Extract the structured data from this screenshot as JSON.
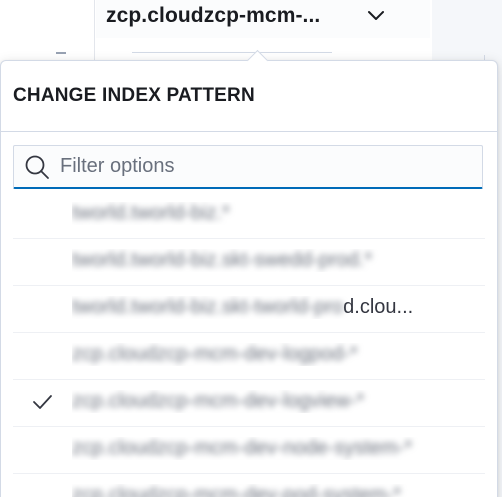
{
  "selector": {
    "title": "zcp.cloudzcp-mcm-..."
  },
  "popover": {
    "title": "CHANGE INDEX PATTERN",
    "search": {
      "placeholder": "Filter options",
      "value": ""
    },
    "options": [
      {
        "label": "tworld.tworld-biz.*",
        "selected": false
      },
      {
        "label": "tworld.tworld-biz.skt-swedd-prod.*",
        "selected": false
      },
      {
        "label": "tworld.tworld-biz.skt-tworld-prod.clou...",
        "selected": false
      },
      {
        "label": "zcp.cloudzcp-mcm-dev-logpod-*",
        "selected": false
      },
      {
        "label": "zcp.cloudzcp-mcm-dev-logview-*",
        "selected": true
      },
      {
        "label": "zcp.cloudzcp-mcm-dev-node-system-*",
        "selected": false
      },
      {
        "label": "zcp.cloudzcp-mcm-dev-pod-system-*",
        "selected": false
      }
    ]
  },
  "icons": {
    "chevron": "chevron-down-icon",
    "clear": "clear-icon",
    "search": "search-icon",
    "check": "check-icon"
  },
  "colors": {
    "accent": "#006bb8",
    "text": "#343741",
    "title": "#1a1c21",
    "border": "#d3dae6"
  }
}
